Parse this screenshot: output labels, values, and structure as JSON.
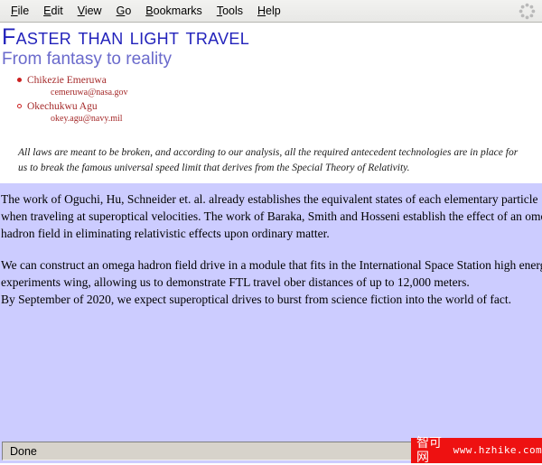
{
  "window": {
    "title": "Faster Than Light Travel"
  },
  "menubar": {
    "items": [
      {
        "label": "File",
        "accel": "F",
        "rest": "ile",
        "name": "menu-file"
      },
      {
        "label": "Edit",
        "accel": "E",
        "rest": "dit",
        "name": "menu-edit"
      },
      {
        "label": "View",
        "accel": "V",
        "rest": "iew",
        "name": "menu-view"
      },
      {
        "label": "Go",
        "accel": "G",
        "rest": "o",
        "name": "menu-go"
      },
      {
        "label": "Bookmarks",
        "accel": "B",
        "rest": "ookmarks",
        "name": "menu-bookmarks"
      },
      {
        "label": "Tools",
        "accel": "T",
        "rest": "ools",
        "name": "menu-tools"
      },
      {
        "label": "Help",
        "accel": "H",
        "rest": "elp",
        "name": "menu-help"
      }
    ],
    "throbber_icon": "throbber-icon"
  },
  "document": {
    "title": "Faster than light travel",
    "subtitle": "From fantasy to reality",
    "authors": [
      {
        "marker": "filled-bullet",
        "name": "Chikezie Emeruwa",
        "email": "cemeruwa@nasa.gov"
      },
      {
        "marker": "hollow-bullet",
        "name": "Okechukwu Agu",
        "email": "okey.agu@navy.mil"
      }
    ],
    "abstract": "All laws are meant to be broken, and according to our analysis, all the required antecedent technologies are in place for us to break the famous universal speed limit that derives from the Special Theory of Relativity.",
    "paragraphs": [
      {
        "lines": [
          "The work of Oguchi, Hu, Schneider et. al. already establishes the equivalent states of each elementary particle",
          "when traveling at superoptical velocities. The work of Baraka, Smith and Hosseni establish the effect of an omega",
          "hadron field in eliminating relativistic effects upon ordinary matter."
        ]
      },
      {
        "lines": [
          "We can construct an omega hadron field drive in a module that fits in the International Space Station high energy",
          "experiments wing, allowing us to demonstrate FTL travel ober distances of up to 12,000 meters.",
          "By September of 2020, we expect superoptical drives to burst from science fiction into the world of fact."
        ]
      }
    ]
  },
  "statusbar": {
    "text": "Done"
  },
  "watermark": {
    "brand": "智可网",
    "url": "www.hzhike.com"
  },
  "colors": {
    "title": "#2222bb",
    "subtitle": "#6a6acc",
    "author": "#a52a2a",
    "body_background": "#ccccff",
    "watermark_background": "#ee1111",
    "menubar_background": "#eeeeee",
    "statusbar_background": "#d7d3cb"
  }
}
